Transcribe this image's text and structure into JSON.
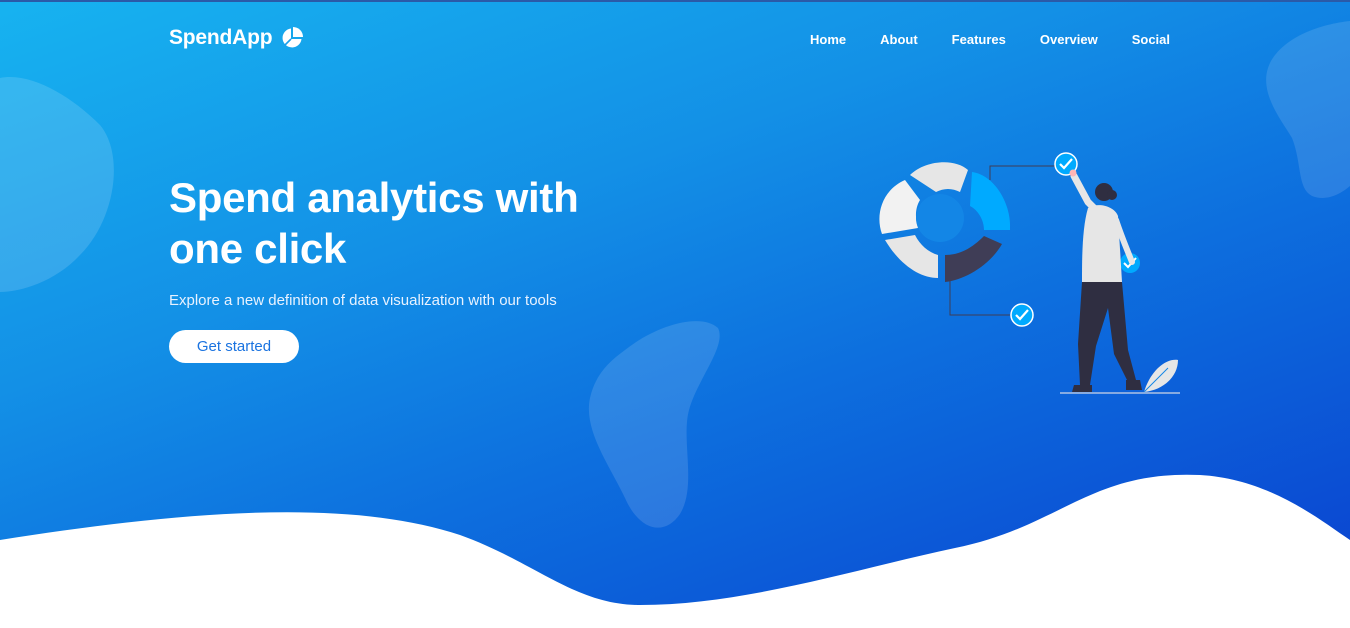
{
  "brand": {
    "name": "SpendApp",
    "logo_icon": "pie-chart-icon"
  },
  "nav": {
    "items": [
      {
        "label": "Home"
      },
      {
        "label": "About"
      },
      {
        "label": "Features"
      },
      {
        "label": "Overview"
      },
      {
        "label": "Social"
      }
    ]
  },
  "hero": {
    "headline_line1": "Spend analytics with",
    "headline_line2": "one click",
    "subtitle": "Explore a new definition of data visualization with our tools",
    "cta_label": "Get started",
    "illustration": "person-checking-chart-illustration"
  },
  "colors": {
    "gradient_start": "#17b3f0",
    "gradient_end": "#0a3fcf",
    "accent": "#00aaff",
    "dark": "#3f3d56"
  }
}
